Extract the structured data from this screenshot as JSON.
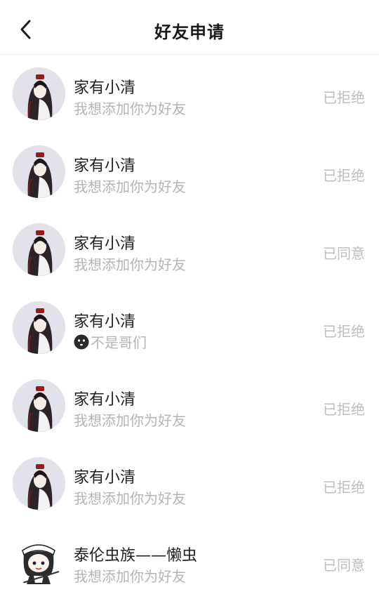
{
  "header": {
    "title": "好友申请",
    "back_icon": "chevron-left-icon"
  },
  "requests": [
    {
      "name": "家有小清",
      "message": "我想添加你为好友",
      "status": "已拒绝",
      "avatar": "girl-avatar",
      "emoji": ""
    },
    {
      "name": "家有小清",
      "message": "我想添加你为好友",
      "status": "已拒绝",
      "avatar": "girl-avatar",
      "emoji": ""
    },
    {
      "name": "家有小清",
      "message": "我想添加你为好友",
      "status": "已同意",
      "avatar": "girl-avatar",
      "emoji": ""
    },
    {
      "name": "家有小清",
      "message": "不是哥们",
      "status": "已拒绝",
      "avatar": "girl-avatar",
      "emoji": "dark-face-emoji"
    },
    {
      "name": "家有小清",
      "message": "我想添加你为好友",
      "status": "已拒绝",
      "avatar": "girl-avatar",
      "emoji": ""
    },
    {
      "name": "家有小清",
      "message": "我想添加你为好友",
      "status": "已拒绝",
      "avatar": "girl-avatar",
      "emoji": ""
    },
    {
      "name": "泰伦虫族——懒虫",
      "message": "我想添加你为好友",
      "status": "已同意",
      "avatar": "maid-chibi-avatar",
      "emoji": ""
    }
  ],
  "colors": {
    "text_primary": "#1f1f1f",
    "text_secondary": "#b4b4b4",
    "status": "#bdbdbd",
    "divider": "#ececec"
  }
}
